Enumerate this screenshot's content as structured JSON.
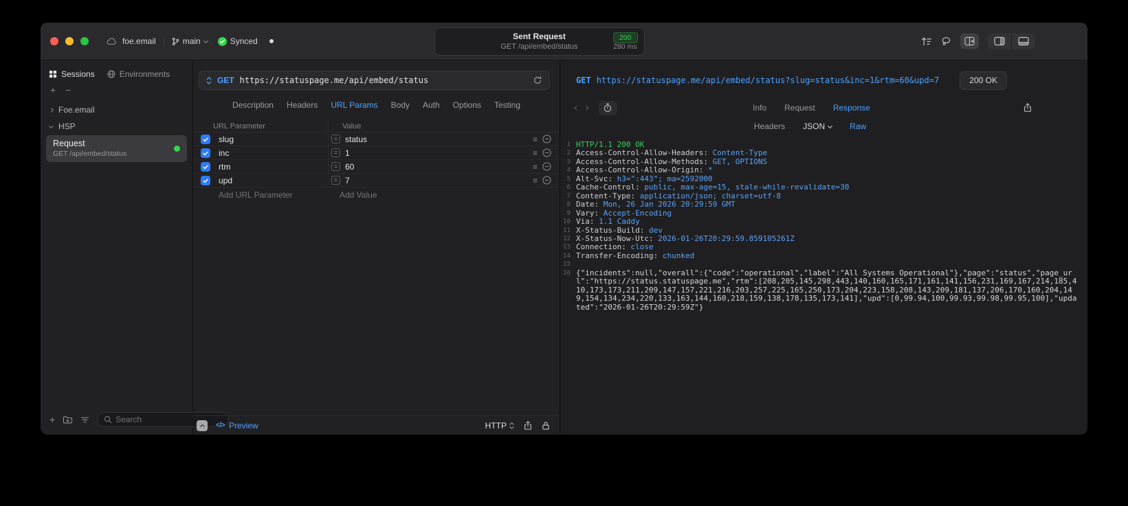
{
  "icons": {
    "add": "+",
    "remove": "−",
    "back": "‹",
    "forward": "›",
    "code": "</>",
    "equals": "=",
    "drag": "≡"
  },
  "colors": {
    "accent": "#4da2ff",
    "green": "#32d74b",
    "checkbox_blue": "#2e7bf6"
  },
  "titlebar": {
    "project": "foe.email",
    "branch": "main",
    "sync_label": "Synced",
    "request_title": "Sent Request",
    "request_status": "200",
    "request_line": "GET /api/embed/status",
    "request_duration": "280 ms"
  },
  "sidebar": {
    "tabs": [
      {
        "label": "Sessions",
        "icon": "sessions-grid-icon",
        "active": true
      },
      {
        "label": "Environments",
        "icon": "globe-icon",
        "active": false
      }
    ],
    "tree": [
      {
        "label": "Foe.email",
        "state": "collapsed"
      },
      {
        "label": "HSP",
        "state": "expanded"
      }
    ],
    "request_item": {
      "title": "Request",
      "subtitle": "GET /api/embed/status",
      "status_dot_color": "#32d74b"
    },
    "search_placeholder": "Search"
  },
  "request": {
    "method": "GET",
    "url": "https://statuspage.me/api/embed/status",
    "tabs": [
      {
        "label": "Description"
      },
      {
        "label": "Headers"
      },
      {
        "label": "URL Params",
        "active": true
      },
      {
        "label": "Body"
      },
      {
        "label": "Auth"
      },
      {
        "label": "Options"
      },
      {
        "label": "Testing"
      }
    ],
    "params": {
      "columns": {
        "name": "URL Parameter",
        "value": "Value"
      },
      "rows": [
        {
          "name": "slug",
          "value": "status",
          "checked": true
        },
        {
          "name": "inc",
          "value": "1",
          "checked": true
        },
        {
          "name": "rtm",
          "value": "60",
          "checked": true
        },
        {
          "name": "upd",
          "value": "7",
          "checked": true
        }
      ],
      "add_name": "Add URL Parameter",
      "add_value": "Add Value"
    },
    "footer": {
      "preview": "Preview",
      "protocol": "HTTP"
    }
  },
  "response": {
    "method": "GET",
    "url": "https://statuspage.me/api/embed/status?slug=status&inc=1&rtm=60&upd=7",
    "status_badge": "200 OK",
    "tabs": [
      {
        "label": "Info"
      },
      {
        "label": "Request"
      },
      {
        "label": "Response",
        "active": true
      }
    ],
    "subtabs": [
      {
        "label": "Headers"
      },
      {
        "label": "JSON",
        "dropdown": true
      },
      {
        "label": "Raw",
        "active": true
      }
    ],
    "lines": [
      {
        "n": "1",
        "type": "status",
        "text": "HTTP/1.1 200 OK"
      },
      {
        "n": "2",
        "type": "header",
        "name": "Access-Control-Allow-Headers",
        "value": "Content-Type"
      },
      {
        "n": "3",
        "type": "header",
        "name": "Access-Control-Allow-Methods",
        "value": "GET, OPTIONS"
      },
      {
        "n": "4",
        "type": "header",
        "name": "Access-Control-Allow-Origin",
        "value": "*"
      },
      {
        "n": "5",
        "type": "header",
        "name": "Alt-Svc",
        "value": "h3=\":443\"; ma=2592000"
      },
      {
        "n": "6",
        "type": "header",
        "name": "Cache-Control",
        "value": "public, max-age=15, stale-while-revalidate=30"
      },
      {
        "n": "7",
        "type": "header",
        "name": "Content-Type",
        "value": "application/json; charset=utf-8"
      },
      {
        "n": "8",
        "type": "header",
        "name": "Date",
        "value": "Mon, 26 Jan 2026 20:29:59 GMT"
      },
      {
        "n": "9",
        "type": "header",
        "name": "Vary",
        "value": "Accept-Encoding"
      },
      {
        "n": "10",
        "type": "header",
        "name": "Via",
        "value": "1.1 Caddy"
      },
      {
        "n": "11",
        "type": "header",
        "name": "X-Status-Build",
        "value": "dev"
      },
      {
        "n": "12",
        "type": "header",
        "name": "X-Status-Now-Utc",
        "value": "2026-01-26T20:29:59.859105261Z"
      },
      {
        "n": "13",
        "type": "header",
        "name": "Connection",
        "value": "close"
      },
      {
        "n": "14",
        "type": "header",
        "name": "Transfer-Encoding",
        "value": "chunked"
      },
      {
        "n": "15",
        "type": "blank"
      },
      {
        "n": "16",
        "type": "body",
        "text": "{\"incidents\":null,\"overall\":{\"code\":\"operational\",\"label\":\"All Systems Operational\"},\"page\":\"status\",\"page_url\":\"https://status.statuspage.me\",\"rtm\":[208,205,145,298,443,140,160,165,171,161,141,156,231,169,167,214,185,410,173,173,211,209,147,157,221,216,203,257,225,165,250,173,204,223,158,208,143,209,181,137,206,170,160,204,149,154,134,234,220,133,163,144,160,218,159,138,178,135,173,141],\"upd\":[0,99.94,100,99.93,99.98,99.95,100],\"updated\":\"2026-01-26T20:29:59Z\"}"
      }
    ]
  }
}
